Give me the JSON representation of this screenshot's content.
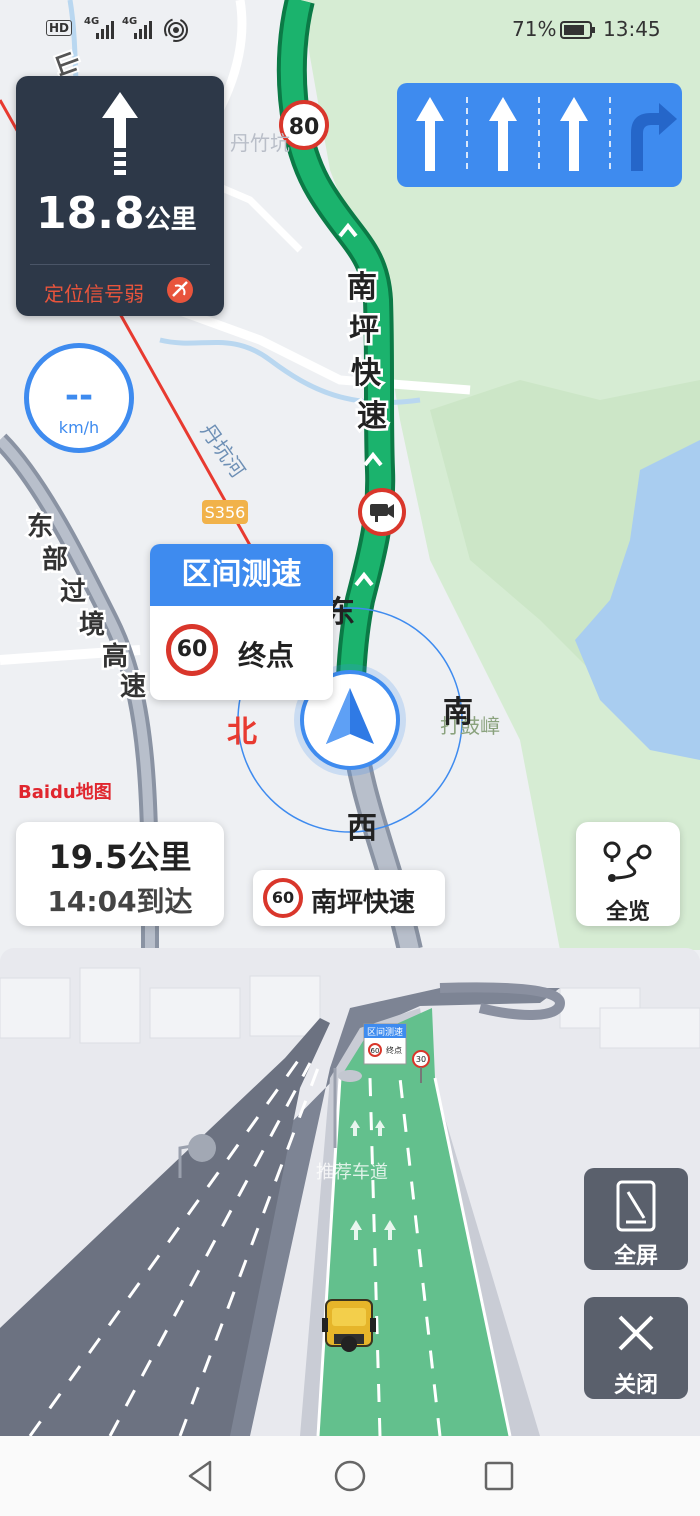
{
  "status_bar": {
    "left_labels": [
      "HD",
      "4G",
      "4G"
    ],
    "battery": "71%",
    "time": "13:45"
  },
  "turn_card": {
    "distance_value": "18.8",
    "distance_unit": "公里",
    "signal_warning": "定位信号弱"
  },
  "speed": {
    "value": "--",
    "unit": "km/h"
  },
  "interval_card": {
    "title": "区间测速",
    "limit": "60",
    "end_label": "终点"
  },
  "map": {
    "speed_limit_sign": "80",
    "road_expressway": [
      "南",
      "坪",
      "快",
      "速"
    ],
    "road_east": [
      "东",
      "部",
      "过",
      "境",
      "高",
      "速"
    ],
    "river": "丹坑河",
    "highway_code": "S356",
    "place": "丹竹坑",
    "place_nearby": "打鼓嶂",
    "compass": {
      "north": "北",
      "east": "东",
      "south": "南",
      "west": "西"
    },
    "logo": "Baidu地图",
    "colors": {
      "route": "#1bb36d",
      "accent": "#3e8bef",
      "warning": "#e0492b"
    }
  },
  "remaining": {
    "distance": "19.5公里",
    "arrival": "14:04到达"
  },
  "current_road": {
    "limit": "60",
    "name": "南坪快速"
  },
  "overview_button": {
    "label": "全览"
  },
  "scene3d": {
    "sign_title": "区间测速",
    "sign_end": "终点",
    "sign_limit": "60",
    "side_limit": "30",
    "lane_text": "推荐车道"
  },
  "fullscreen_button": {
    "label": "全屏"
  },
  "close_button": {
    "label": "关闭"
  },
  "nav_bar": {
    "icons": [
      "back-icon",
      "home-icon",
      "recents-icon"
    ]
  }
}
